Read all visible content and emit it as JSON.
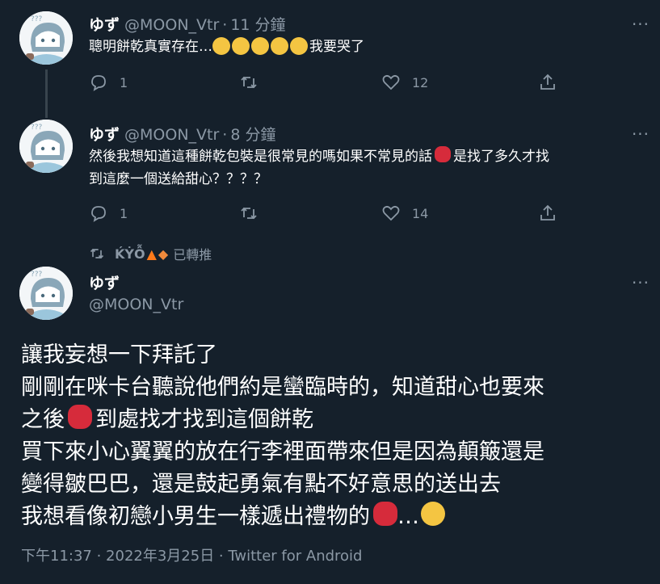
{
  "tweets": [
    {
      "display_name": "ゆず",
      "handle": "@MOON_Vtr",
      "separator": "·",
      "time": "11 分鐘",
      "text_before": "聰明餅乾真實存在…",
      "text_after": "我要哭了",
      "replies": "1",
      "retweets": "",
      "likes": "12"
    },
    {
      "display_name": "ゆず",
      "handle": "@MOON_Vtr",
      "separator": "·",
      "time": "8 分鐘",
      "line1_before": "然後我想知道這種餅乾包裝是很常見的嗎如果不常見的話",
      "line1_after": "是找了多久才找",
      "line2": "到這麼一個送給甜心？？？？",
      "replies": "1",
      "retweets": "",
      "likes": "14"
    }
  ],
  "retweet_context": {
    "name": "ḰẎỖ",
    "label": "已轉推"
  },
  "main_tweet": {
    "display_name": "ゆず",
    "handle": "@MOON_Vtr",
    "lines": [
      "讓我妄想一下拜託了",
      "剛剛在咪卡台聽說他們約是蠻臨時的，知道甜心也要來",
      "之後",
      "到處找才找到這個餅乾",
      "買下來小心翼翼的放在行李裡面帶來但是因為顛簸還是",
      "變得皺巴巴，還是鼓起勇氣有點不好意思的送出去",
      "我想看像初戀小男生一樣遞出禮物的",
      "…"
    ],
    "meta": "下午11:37 · 2022年3月25日 · Twitter for Android"
  },
  "icons": {
    "reply": "reply-icon",
    "retweet": "retweet-icon",
    "like": "like-icon",
    "share": "share-icon",
    "more": "more-icon"
  },
  "colors": {
    "background": "#15202b",
    "muted": "#8b98a5",
    "text": "#ffffff"
  }
}
